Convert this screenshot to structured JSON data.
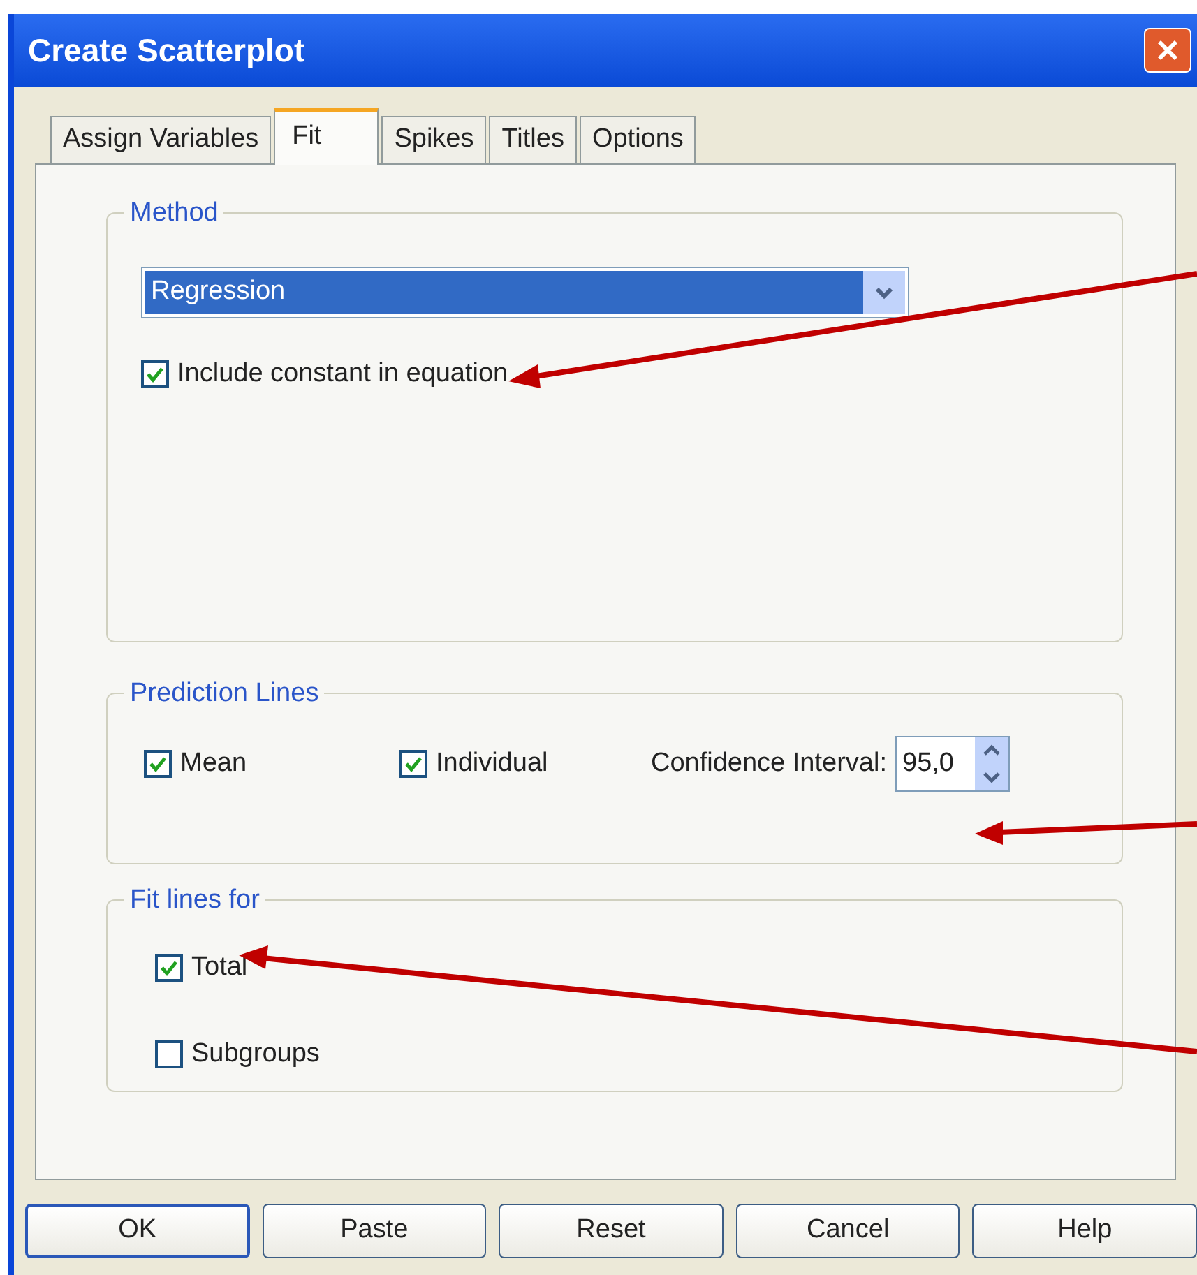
{
  "window": {
    "title": "Create Scatterplot"
  },
  "tabs": [
    {
      "label": "Assign Variables",
      "selected": false
    },
    {
      "label": "Fit",
      "selected": true
    },
    {
      "label": "Spikes",
      "selected": false
    },
    {
      "label": "Titles",
      "selected": false
    },
    {
      "label": "Options",
      "selected": false
    }
  ],
  "method": {
    "legend": "Method",
    "dropdown": {
      "value": "Regression"
    },
    "include_constant": {
      "label": "Include constant in equation",
      "checked": true
    }
  },
  "prediction_lines": {
    "legend": "Prediction Lines",
    "mean": {
      "label": "Mean",
      "checked": true
    },
    "individual": {
      "label": "Individual",
      "checked": true
    },
    "confidence_interval": {
      "label": "Confidence Interval:",
      "value": "95,0"
    }
  },
  "fit_lines_for": {
    "legend": "Fit lines for",
    "options": [
      {
        "label": "Total",
        "checked": true
      },
      {
        "label": "Subgroups",
        "checked": false
      }
    ]
  },
  "buttons": [
    {
      "label": "OK",
      "default": true
    },
    {
      "label": "Paste",
      "default": false
    },
    {
      "label": "Reset",
      "default": false
    },
    {
      "label": "Cancel",
      "default": false
    },
    {
      "label": "Help",
      "default": false
    }
  ]
}
